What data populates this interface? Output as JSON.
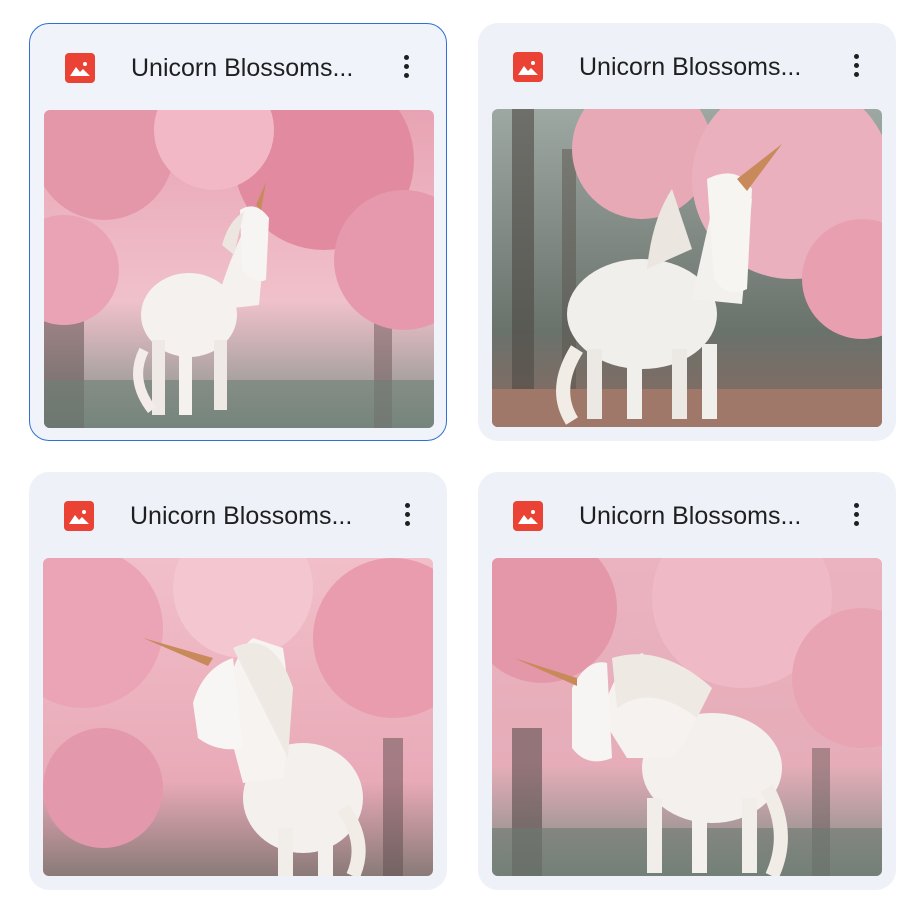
{
  "files": [
    {
      "title": "Unicorn Blossoms...",
      "icon": "image-file-icon",
      "selected": true,
      "thumbnail": "unicorn-under-pink-blossom-trees"
    },
    {
      "title": "Unicorn Blossoms...",
      "icon": "image-file-icon",
      "selected": false,
      "thumbnail": "unicorn-under-pink-blossom-trees"
    },
    {
      "title": "Unicorn Blossoms...",
      "icon": "image-file-icon",
      "selected": false,
      "thumbnail": "unicorn-under-pink-blossom-trees"
    },
    {
      "title": "Unicorn Blossoms...",
      "icon": "image-file-icon",
      "selected": false,
      "thumbnail": "unicorn-under-pink-blossom-trees"
    }
  ],
  "colors": {
    "card_background": "#eef2f8",
    "selection_border": "#2f6fd6",
    "file_icon": "#ea4335",
    "title_text": "#1f1f1f",
    "blossom_pink": "#f2b6c2",
    "unicorn_white": "#f4f1ef"
  }
}
